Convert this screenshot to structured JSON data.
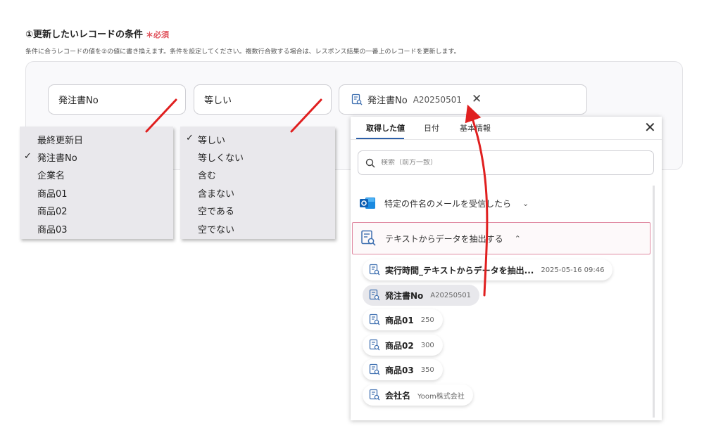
{
  "section": {
    "title": "①更新したいレコードの条件",
    "required_label": "＊必須",
    "description": "条件に合うレコードの値を②の値に書き換えます。条件を設定してください。複数行合致する場合は、レスポンス結果の一番上のレコードを更新します。"
  },
  "condition": {
    "field_value": "発注書No",
    "operator_value": "等しい",
    "value_chip": {
      "label": "発注書No",
      "value": "A20250501"
    }
  },
  "field_dropdown": {
    "options": [
      "最終更新日",
      "発注書No",
      "企業名",
      "商品01",
      "商品02",
      "商品03"
    ],
    "selected": "発注書No"
  },
  "operator_dropdown": {
    "options": [
      "等しい",
      "等しくない",
      "含む",
      "含まない",
      "空である",
      "空でない"
    ],
    "selected": "等しい"
  },
  "picker": {
    "tabs": [
      "取得した値",
      "日付",
      "基本情報"
    ],
    "active_tab": "取得した値",
    "search_placeholder": "検索（前方一致）",
    "groups": [
      {
        "label": "特定の件名のメールを受信したら",
        "icon": "outlook-icon",
        "expanded": false
      },
      {
        "label": "テキストからデータを抽出する",
        "icon": "document-search-icon",
        "expanded": true
      }
    ],
    "items": [
      {
        "label": "実行時間_テキストからデータを抽出...",
        "value": "2025-05-16 09:46"
      },
      {
        "label": "発注書No",
        "value": "A20250501"
      },
      {
        "label": "商品01",
        "value": "250"
      },
      {
        "label": "商品02",
        "value": "300"
      },
      {
        "label": "商品03",
        "value": "350"
      },
      {
        "label": "会社名",
        "value": "Yoom株式会社"
      }
    ]
  },
  "colors": {
    "accent": "#2c5fa8",
    "required": "#e0505a",
    "annotation": "#e01f1f",
    "group_highlight": "#e08aa2"
  }
}
